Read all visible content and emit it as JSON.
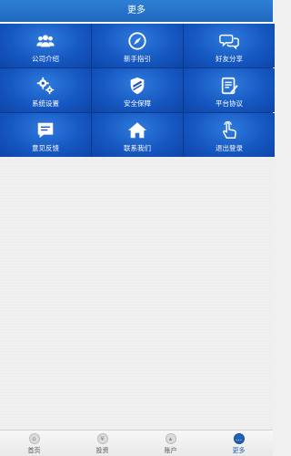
{
  "header": {
    "title": "更多"
  },
  "menu": [
    {
      "label": "公司介绍",
      "icon": "group-icon"
    },
    {
      "label": "新手指引",
      "icon": "compass-icon"
    },
    {
      "label": "好友分享",
      "icon": "chat-bubbles-icon"
    },
    {
      "label": "系统设置",
      "icon": "gears-icon"
    },
    {
      "label": "安全保障",
      "icon": "shield-icon"
    },
    {
      "label": "平台协议",
      "icon": "document-icon"
    },
    {
      "label": "意见反馈",
      "icon": "feedback-icon"
    },
    {
      "label": "联系我们",
      "icon": "home-icon"
    },
    {
      "label": "退出登录",
      "icon": "hand-pointer-icon"
    }
  ],
  "tabbar": {
    "items": [
      {
        "label": "首页",
        "icon": "home-tab-icon",
        "active": false
      },
      {
        "label": "投资",
        "icon": "money-tab-icon",
        "active": false
      },
      {
        "label": "账户",
        "icon": "user-tab-icon",
        "active": false
      },
      {
        "label": "更多",
        "icon": "more-tab-icon",
        "active": true
      }
    ]
  },
  "colors": {
    "header": "#2770c8",
    "tile": "#1658c2",
    "tile_border": "#0a3a8a",
    "active_tab": "#1f63b8",
    "background": "#f0f0f0"
  }
}
